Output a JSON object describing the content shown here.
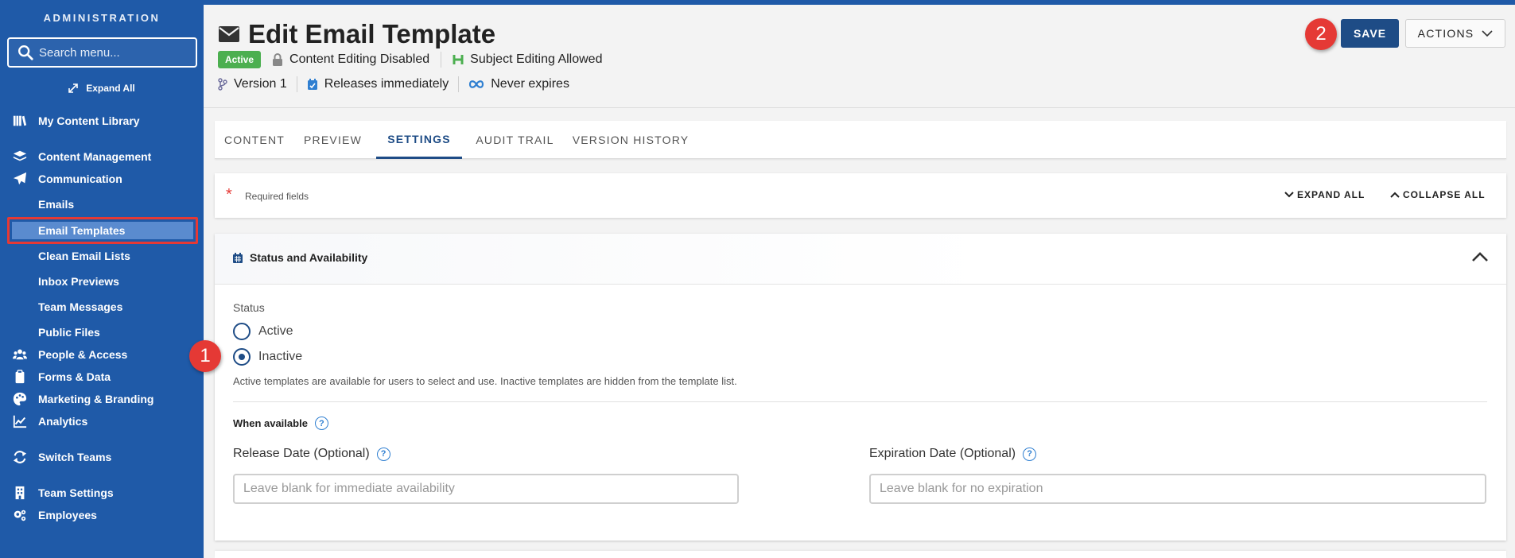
{
  "sidebar": {
    "heading": "ADMINISTRATION",
    "search_placeholder": "Search menu...",
    "expand_all": "Expand All",
    "items": {
      "my_content_library": "My Content Library",
      "content_management": "Content Management",
      "communication": "Communication",
      "emails": "Emails",
      "email_templates": "Email Templates",
      "clean_email_lists": "Clean Email Lists",
      "inbox_previews": "Inbox Previews",
      "team_messages": "Team Messages",
      "public_files": "Public Files",
      "people_access": "People & Access",
      "forms_data": "Forms & Data",
      "marketing_branding": "Marketing & Branding",
      "analytics": "Analytics",
      "switch_teams": "Switch Teams",
      "team_settings": "Team Settings",
      "employees": "Employees"
    }
  },
  "header": {
    "title": "Edit Email Template",
    "status_badge": "Active",
    "content_editing": "Content Editing Disabled",
    "subject_editing": "Subject Editing Allowed",
    "version": "Version 1",
    "release": "Releases immediately",
    "expiry": "Never expires",
    "save_label": "SAVE",
    "actions_label": "ACTIONS"
  },
  "markers": {
    "one": "1",
    "two": "2"
  },
  "tabs": [
    "CONTENT",
    "PREVIEW",
    "SETTINGS",
    "AUDIT TRAIL",
    "VERSION HISTORY"
  ],
  "active_tab": "SETTINGS",
  "required": {
    "star": "*",
    "text": "Required fields",
    "expand_all": "EXPAND ALL",
    "collapse_all": "COLLAPSE ALL"
  },
  "panel": {
    "title": "Status and Availability",
    "status_label": "Status",
    "options": [
      "Active",
      "Inactive"
    ],
    "selected": "Inactive",
    "helper": "Active templates are available for users to select and use. Inactive templates are hidden from the template list.",
    "when_available": "When available",
    "help_icon": "?",
    "release_label": "Release Date (Optional)",
    "release_placeholder": "Leave blank for immediate availability",
    "expiration_label": "Expiration Date (Optional)",
    "expiration_placeholder": "Leave blank for no expiration"
  },
  "colors": {
    "sidebar_bg": "#1f5aa8",
    "primary": "#1e4c86",
    "badge_green": "#4caf50",
    "marker_red": "#e53935"
  }
}
